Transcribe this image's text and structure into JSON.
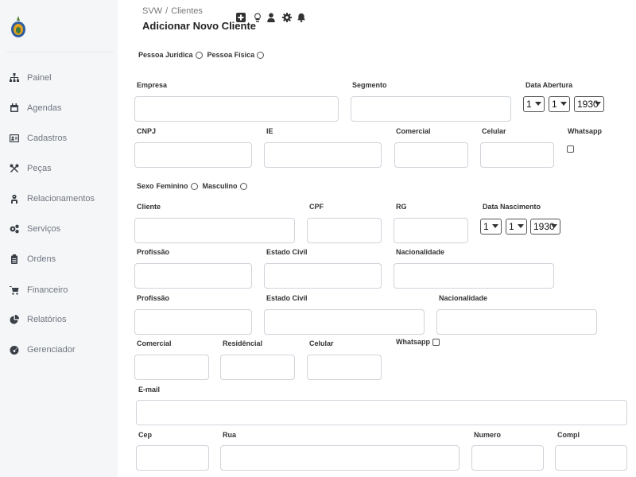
{
  "sidebar": {
    "items": [
      {
        "label": "Painel",
        "icon": "sitemap-icon"
      },
      {
        "label": "Agendas",
        "icon": "calendar-icon"
      },
      {
        "label": "Cadastros",
        "icon": "id-card-icon"
      },
      {
        "label": "Peças",
        "icon": "tools-icon"
      },
      {
        "label": "Relacionamentos",
        "icon": "user-tie-icon"
      },
      {
        "label": "Serviços",
        "icon": "cogs-icon"
      },
      {
        "label": "Ordens",
        "icon": "clipboard-icon"
      },
      {
        "label": "Financeiro",
        "icon": "cart-icon"
      },
      {
        "label": "Relatórios",
        "icon": "pie-chart-icon"
      },
      {
        "label": "Gerenciador",
        "icon": "dashboard-icon"
      }
    ]
  },
  "header": {
    "breadcrumb": {
      "root": "SVW",
      "separator": "/",
      "current": "Clientes"
    },
    "title": "Adicionar Novo Cliente"
  },
  "form": {
    "person_type": {
      "juridica": "Pessoa Jurídica",
      "fisica": "Pessoa Física"
    },
    "company": {
      "empresa": "Empresa",
      "segmento": "Segmento",
      "data_abertura": "Data Abertura",
      "date_values": {
        "day": "1",
        "month": "1",
        "year": "1930"
      },
      "cnpj": "CNPJ",
      "ie": "IE",
      "comercial": "Comercial",
      "celular": "Celular",
      "whatsapp": "Whatsapp"
    },
    "sex": {
      "label": "Sexo",
      "feminino": "Feminino",
      "masculino": "Masculino"
    },
    "client": {
      "cliente": "Cliente",
      "cpf": "CPF",
      "rg": "RG",
      "data_nascimento": "Data Nascimento",
      "date_values": {
        "day": "1",
        "month": "1",
        "year": "1930"
      },
      "profissao": "Profissão",
      "estado_civil": "Estado Civil",
      "nacionalidade": "Nacionalidade"
    },
    "second": {
      "profissao": "Profissão",
      "estado_civil": "Estado Civil",
      "nacionalidade": "Nacionalidade"
    },
    "contact": {
      "comercial": "Comercial",
      "residencial": "Residêncial",
      "celular": "Celular",
      "whatsapp": "Whatsapp",
      "email": "E-mail"
    },
    "address": {
      "cep": "Cep",
      "rua": "Rua",
      "numero": "Numero",
      "compl": "Compl"
    }
  }
}
